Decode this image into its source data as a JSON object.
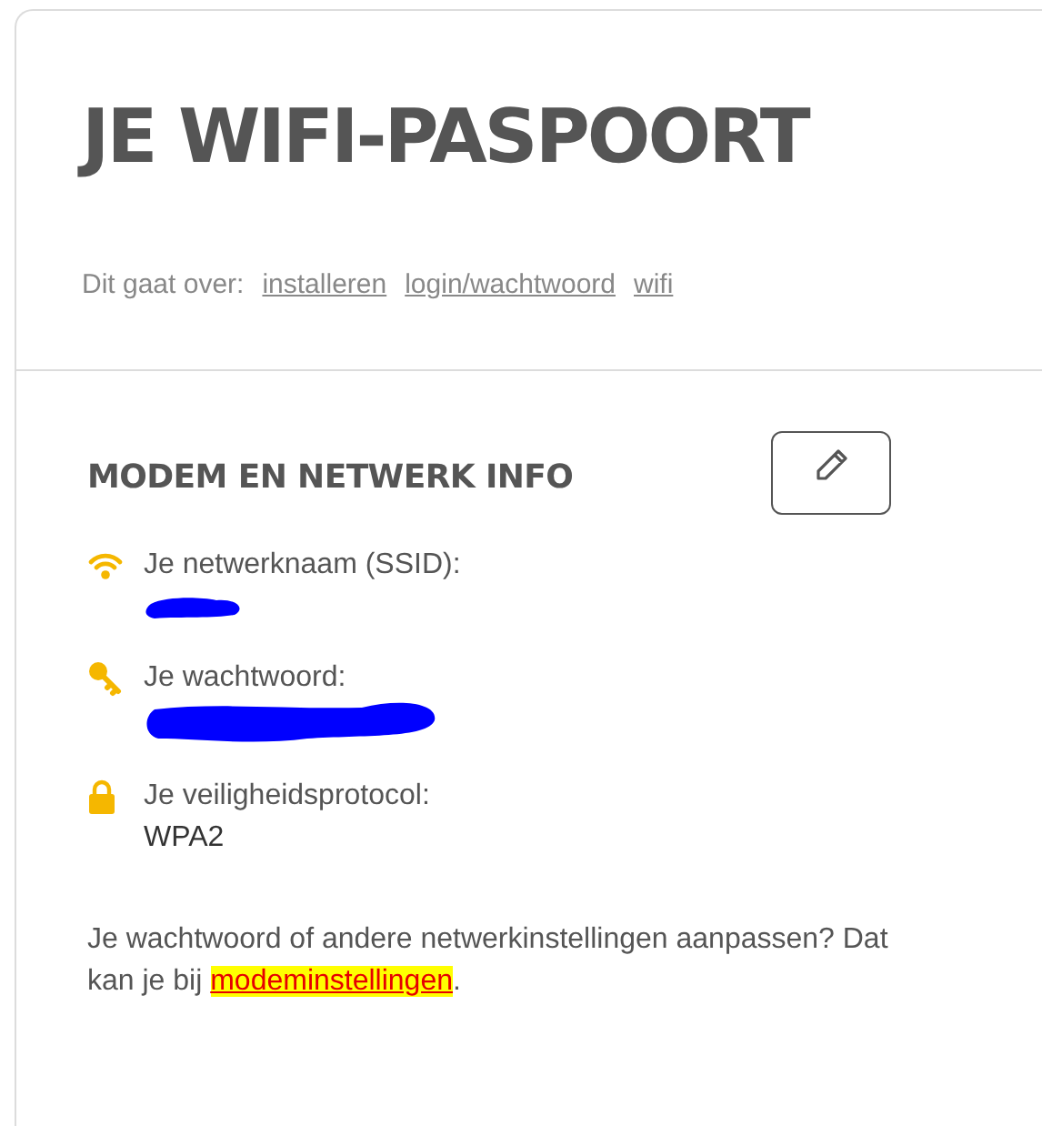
{
  "page": {
    "title": "JE WIFI-PASPOORT",
    "topics_label": "Dit gaat over:",
    "topics": [
      "installeren",
      "login/wachtwoord",
      "wifi"
    ]
  },
  "section": {
    "heading": "MODEM EN NETWERK INFO",
    "rows": [
      {
        "kind": "wifi",
        "label": "Je netwerknaam (SSID):",
        "redacted": true
      },
      {
        "kind": "key",
        "label": "Je wachtwoord:",
        "redacted": true
      },
      {
        "kind": "lock",
        "label": "Je veiligheidsprotocol:",
        "redacted": false,
        "value": "WPA2"
      }
    ],
    "note": {
      "before": "Je wachtwoord of andere netwerkinstellingen aanpassen? Dat kan je bij ",
      "link": "modeminstellingen",
      "link_highlighted": true,
      "after": "."
    }
  }
}
